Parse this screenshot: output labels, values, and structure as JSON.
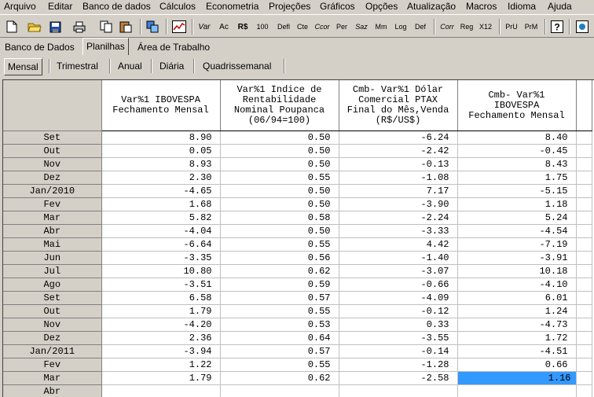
{
  "menu": [
    "Arquivo",
    "Editar",
    "Banco de dados",
    "Cálculos",
    "Econometria",
    "Projeções",
    "Gráficos",
    "Opções",
    "Atualização",
    "Macros",
    "Idioma",
    "Ajuda"
  ],
  "toolbar": {
    "text_buttons": [
      "Var",
      "Ac",
      "R$",
      "100",
      "Defl",
      "Cte",
      "Ccor",
      "Per",
      "Saz",
      "Mm",
      "Log",
      "Def",
      "Corr",
      "Reg",
      "X12",
      "PrU",
      "PrM"
    ],
    "icons": [
      "new-file-icon",
      "open-folder-icon",
      "save-icon",
      "print-icon",
      "copy-icon",
      "paste-icon",
      "database-icon",
      "line-chart-icon",
      "help-icon",
      "exit-icon"
    ]
  },
  "main_tabs": [
    "Banco de Dados",
    "Planilhas",
    "Área de Trabalho"
  ],
  "active_main_tab": "Planilhas",
  "freq_tabs": [
    "Mensal",
    "Trimestral",
    "Anual",
    "Diária",
    "Quadrissemanal"
  ],
  "active_freq_tab": "Mensal",
  "columns": [
    "Var%1 IBOVESPA\nFechamento Mensal",
    "Var%1 Indice de\nRentabilidade\nNominal Poupanca\n(06/94=100)",
    "Cmb- Var%1 Dólar\nComercial PTAX\nFinal do Mês,Venda\n(R$/US$)",
    "Cmb- Var%1\nIBOVESPA\nFechamento Mensal"
  ],
  "rows": [
    {
      "label": "Set",
      "values": [
        "8.90",
        "0.50",
        "-6.24",
        "8.40"
      ]
    },
    {
      "label": "Out",
      "values": [
        "0.05",
        "0.50",
        "-2.42",
        "-0.45"
      ]
    },
    {
      "label": "Nov",
      "values": [
        "8.93",
        "0.50",
        "-0.13",
        "8.43"
      ]
    },
    {
      "label": "Dez",
      "values": [
        "2.30",
        "0.55",
        "-1.08",
        "1.75"
      ]
    },
    {
      "label": "Jan/2010",
      "values": [
        "-4.65",
        "0.50",
        "7.17",
        "-5.15"
      ]
    },
    {
      "label": "Fev",
      "values": [
        "1.68",
        "0.50",
        "-3.90",
        "1.18"
      ]
    },
    {
      "label": "Mar",
      "values": [
        "5.82",
        "0.58",
        "-2.24",
        "5.24"
      ]
    },
    {
      "label": "Abr",
      "values": [
        "-4.04",
        "0.50",
        "-3.33",
        "-4.54"
      ]
    },
    {
      "label": "Mai",
      "values": [
        "-6.64",
        "0.55",
        "4.42",
        "-7.19"
      ]
    },
    {
      "label": "Jun",
      "values": [
        "-3.35",
        "0.56",
        "-1.40",
        "-3.91"
      ]
    },
    {
      "label": "Jul",
      "values": [
        "10.80",
        "0.62",
        "-3.07",
        "10.18"
      ]
    },
    {
      "label": "Ago",
      "values": [
        "-3.51",
        "0.59",
        "-0.66",
        "-4.10"
      ]
    },
    {
      "label": "Set",
      "values": [
        "6.58",
        "0.57",
        "-4.09",
        "6.01"
      ]
    },
    {
      "label": "Out",
      "values": [
        "1.79",
        "0.55",
        "-0.12",
        "1.24"
      ]
    },
    {
      "label": "Nov",
      "values": [
        "-4.20",
        "0.53",
        "0.33",
        "-4.73"
      ]
    },
    {
      "label": "Dez",
      "values": [
        "2.36",
        "0.64",
        "-3.55",
        "1.72"
      ]
    },
    {
      "label": "Jan/2011",
      "values": [
        "-3.94",
        "0.57",
        "-0.14",
        "-4.51"
      ]
    },
    {
      "label": "Fev",
      "values": [
        "1.22",
        "0.55",
        "-1.28",
        "0.66"
      ]
    },
    {
      "label": "Mar",
      "values": [
        "1.79",
        "0.62",
        "-2.58",
        "1.16"
      ]
    },
    {
      "label": "Abr",
      "values": [
        "",
        "",
        "",
        ""
      ]
    }
  ],
  "selected_cell": {
    "row": 18,
    "col": 3
  },
  "colors": {
    "selection": "#3399ff",
    "chrome": "#d4d0c8"
  }
}
